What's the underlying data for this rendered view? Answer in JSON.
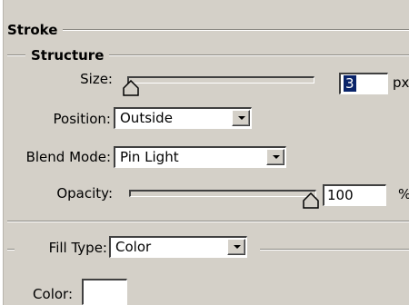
{
  "stroke": {
    "title": "Stroke",
    "structure": {
      "title": "Structure",
      "size": {
        "label": "Size:",
        "value": "3",
        "unit": "px",
        "slider_level": 0.0
      },
      "position": {
        "label": "Position:",
        "selected": "Outside"
      },
      "blend_mode": {
        "label": "Blend Mode:",
        "selected": "Pin Light"
      },
      "opacity": {
        "label": "Opacity:",
        "value": "100",
        "unit": "%",
        "slider_level": 1.0
      }
    },
    "fill_type": {
      "label": "Fill Type:",
      "selected": "Color"
    },
    "color": {
      "label": "Color:",
      "swatch": "#ffffff"
    }
  },
  "colors": {
    "panel_bg": "#d4d0c8",
    "selection": "#0a246a"
  },
  "icons": {
    "slider_thumb": "slider-thumb-icon",
    "dropdown": "chevron-down-icon"
  }
}
